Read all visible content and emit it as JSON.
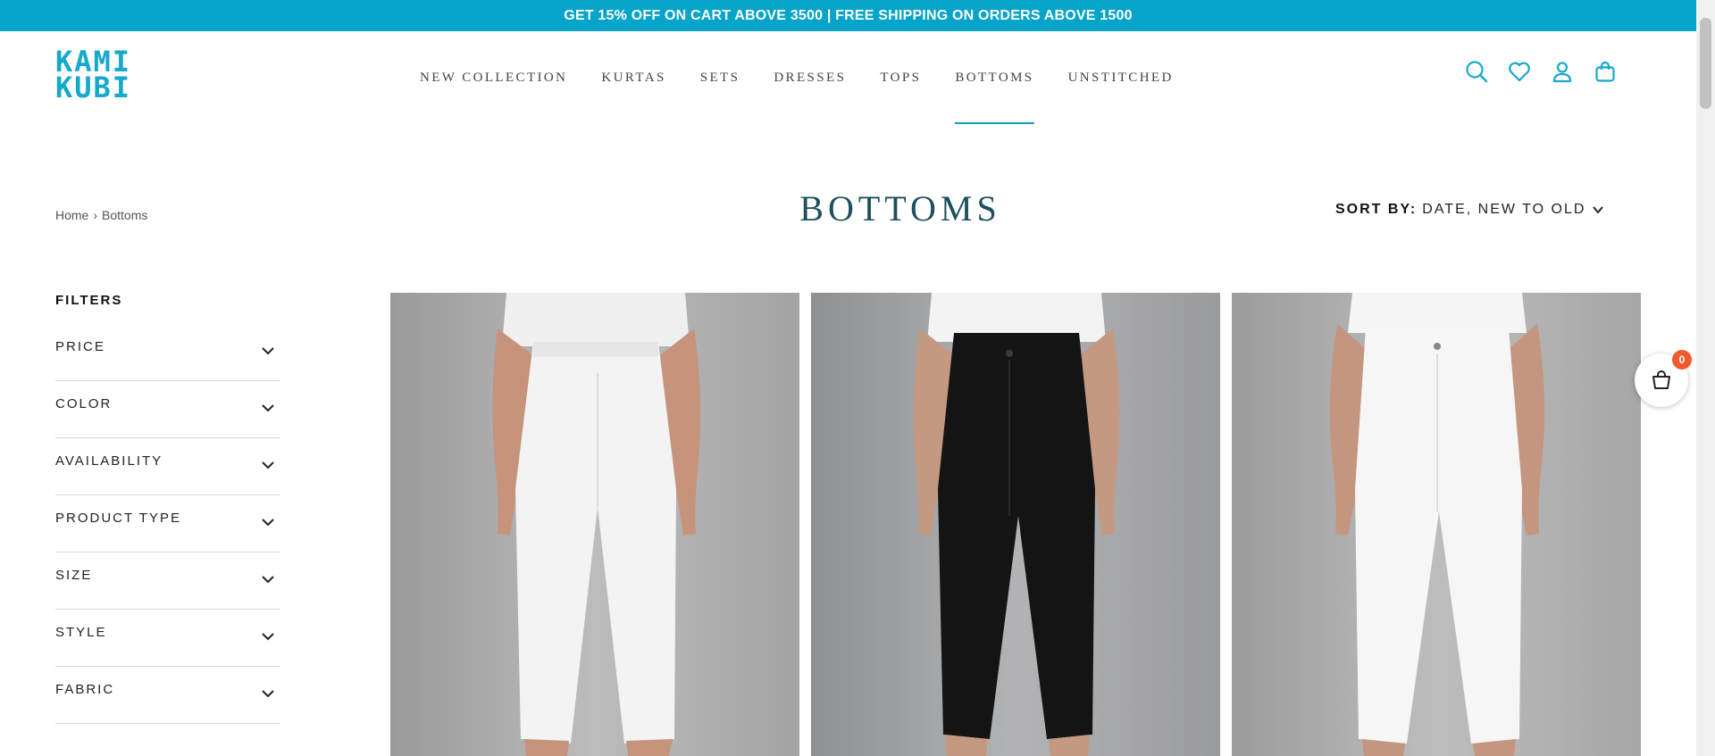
{
  "announcement": {
    "text": "GET 15% OFF ON CART ABOVE 3500 | FREE SHIPPING ON ORDERS ABOVE 1500"
  },
  "brand": {
    "logo_line1": "KAMI",
    "logo_line2": "KUBI",
    "accent_color": "#06a4c9"
  },
  "nav": {
    "items": [
      {
        "label": "NEW COLLECTION"
      },
      {
        "label": "KURTAS"
      },
      {
        "label": "SETS"
      },
      {
        "label": "DRESSES"
      },
      {
        "label": "TOPS"
      },
      {
        "label": "BOTTOMS",
        "active": true
      },
      {
        "label": "UNSTITCHED"
      }
    ]
  },
  "header_icons": [
    "search-icon",
    "heart-icon",
    "user-icon",
    "bag-icon"
  ],
  "breadcrumb": {
    "home": "Home",
    "separator": "›",
    "current": "Bottoms"
  },
  "page": {
    "title": "BOTTOMS"
  },
  "sort": {
    "label": "SORT BY:",
    "value": "DATE, NEW TO OLD"
  },
  "filters": {
    "title": "FILTERS",
    "items": [
      {
        "label": "PRICE"
      },
      {
        "label": "COLOR"
      },
      {
        "label": "AVAILABILITY"
      },
      {
        "label": "PRODUCT TYPE"
      },
      {
        "label": "SIZE"
      },
      {
        "label": "STYLE"
      },
      {
        "label": "FABRIC"
      }
    ]
  },
  "products": [
    {
      "color": "white",
      "pants_hex": "#f4f4f4"
    },
    {
      "color": "black",
      "pants_hex": "#151515"
    },
    {
      "color": "white",
      "pants_hex": "#f7f7f7"
    }
  ],
  "floating_cart": {
    "count": "0",
    "badge_color": "#f25a2c"
  }
}
